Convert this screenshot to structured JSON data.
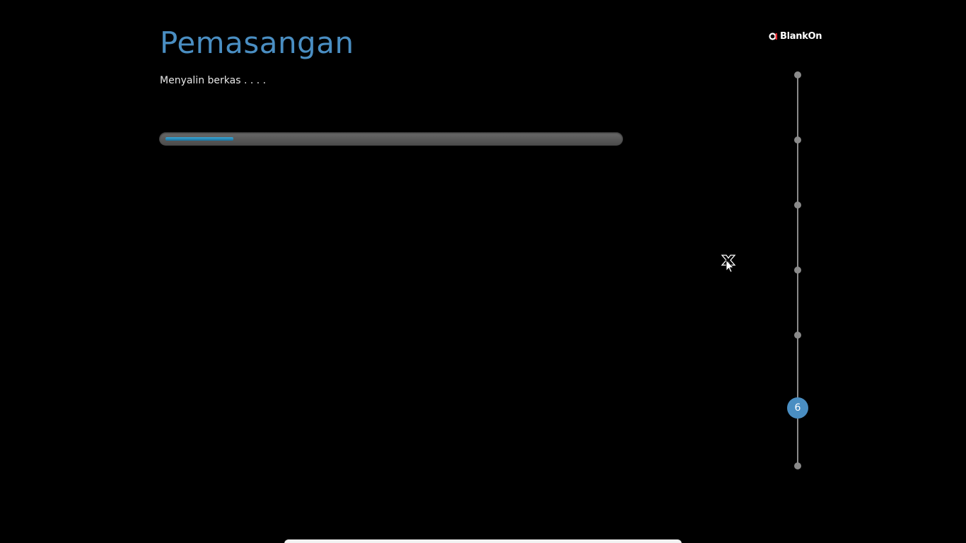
{
  "installer": {
    "title": "Pemasangan",
    "status_text": "Menyalin berkas . . . .",
    "progress_fraction": 0.15
  },
  "brand": {
    "logo_text": "BlankOn",
    "mark_color": "#e0242b"
  },
  "steps": {
    "total": 7,
    "current_label": "6",
    "current_index": 5
  },
  "colors": {
    "accent": "#4a8ec2",
    "progress": "#2b8fc2",
    "step_inactive": "#8a8a8a"
  }
}
